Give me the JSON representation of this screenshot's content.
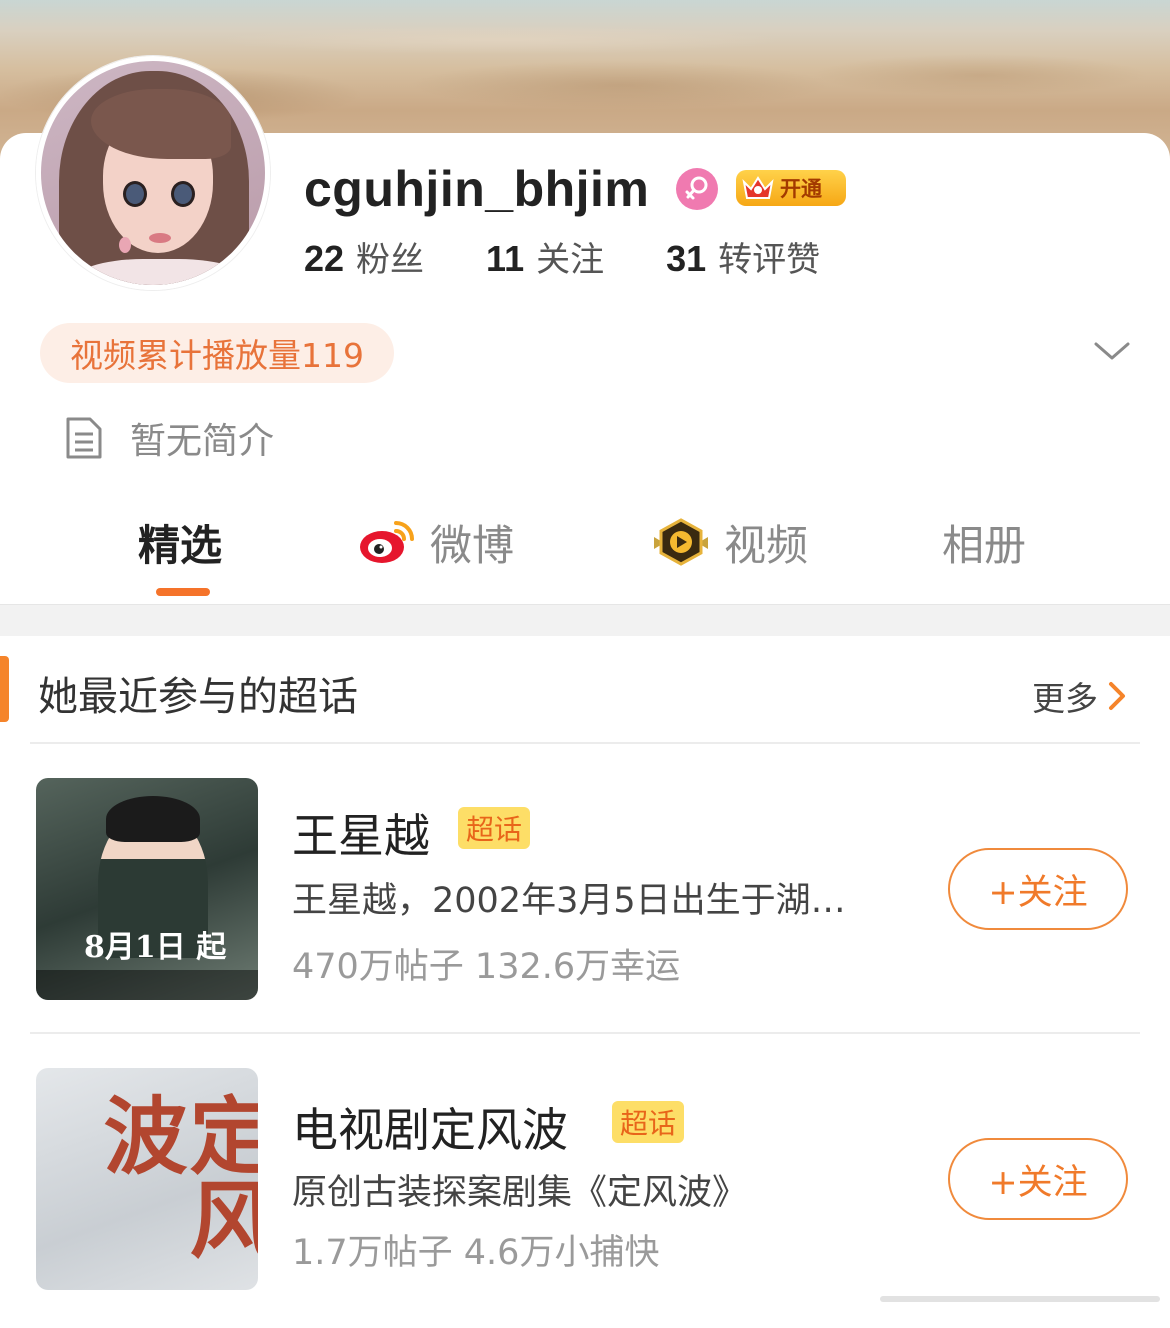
{
  "profile": {
    "username": "cguhjin_bhjim",
    "vip_label": "开通",
    "stats": [
      {
        "num": "22",
        "label": "粉丝"
      },
      {
        "num": "11",
        "label": "关注"
      },
      {
        "num": "31",
        "label": "转评赞"
      }
    ],
    "play_count": "视频累计播放量119",
    "bio": "暂无简介"
  },
  "tabs": [
    {
      "label": "精选",
      "active": true
    },
    {
      "label": "微博",
      "icon": "weibo-logo-icon"
    },
    {
      "label": "视频",
      "icon": "video-play-icon"
    },
    {
      "label": "相册"
    }
  ],
  "section": {
    "title": "她最近参与的超话",
    "more": "更多"
  },
  "topics": [
    {
      "title": "王星越",
      "badge": "超话",
      "desc": "王星越，2002年3月5日出生于湖…",
      "stats": "470万帖子 132.6万幸运",
      "follow": "+关注",
      "thumb_text": "8月1日 起"
    },
    {
      "title": "电视剧定风波",
      "badge": "超话",
      "desc": "原创古装探案剧集《定风波》",
      "stats": "1.7万帖子 4.6万小捕快",
      "follow": "+关注",
      "thumb_text": "定风波"
    }
  ],
  "colors": {
    "accent": "#f5732a",
    "pill_bg": "#fdeee6",
    "badge_bg": "#fdde67",
    "female_badge": "#f07ab0"
  }
}
